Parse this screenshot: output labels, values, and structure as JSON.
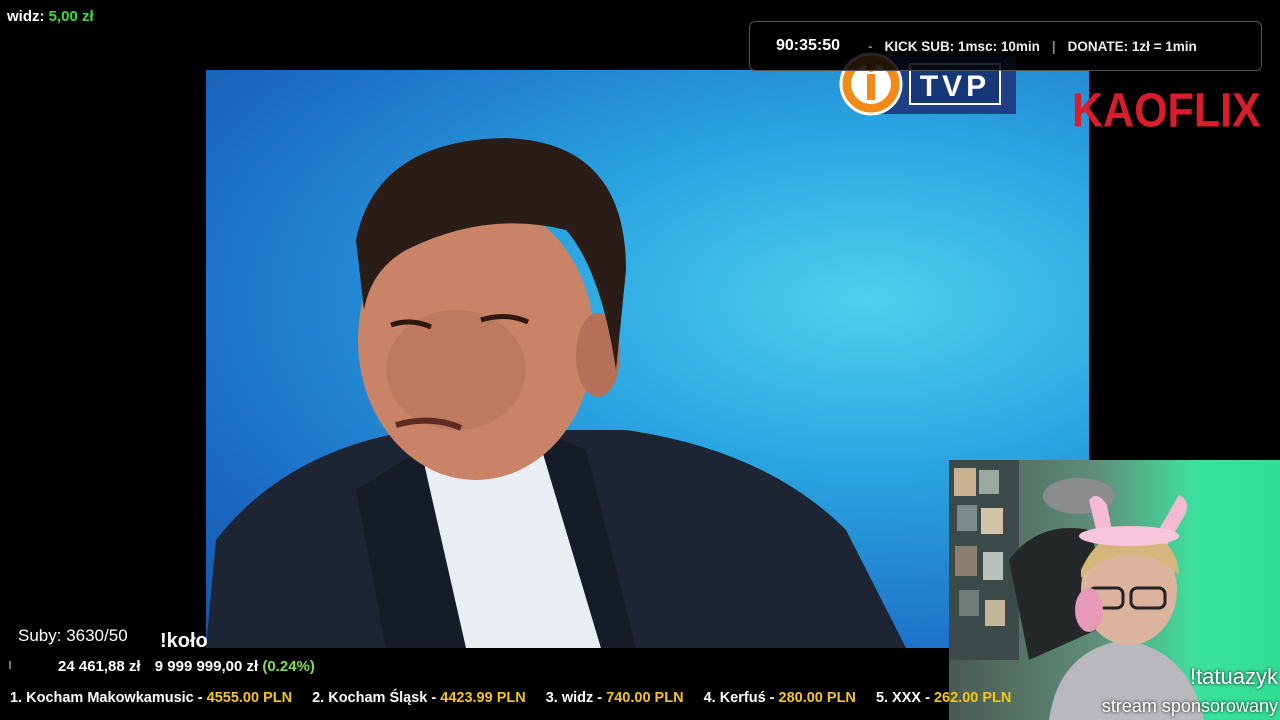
{
  "top_left": {
    "label": "widz:",
    "value": "5,00 zł"
  },
  "timer": {
    "time": "90:35:50",
    "dash": "-",
    "kick": "KICK SUB: 1msc: 10min",
    "sep": "|",
    "donate": "DONATE: 1zł = 1min"
  },
  "channel_logo": {
    "text": "TVP"
  },
  "brand": {
    "text": "KAOFLIX"
  },
  "subs": {
    "text": "Suby: 3630/50"
  },
  "kolo": {
    "text": "!koło"
  },
  "goal": {
    "amount": "24 461,88 zł",
    "target": "9 999 999,00 zł",
    "percent": "(0.24%)"
  },
  "ranking": [
    {
      "label": "1. Kocham Makowkamusic - ",
      "amount": "4555.00 PLN"
    },
    {
      "label": "2. Kocham Śląsk - ",
      "amount": "4423.99 PLN"
    },
    {
      "label": "3. widz - ",
      "amount": "740.00 PLN"
    },
    {
      "label": "4. Kerfuś - ",
      "amount": "280.00 PLN"
    },
    {
      "label": "5. XXX - ",
      "amount": "262.00 PLN"
    }
  ],
  "webcam": {
    "command": "!tatuazyk",
    "note": "stream sponsorowany"
  },
  "colors": {
    "accent_green": "#3ddc3d",
    "amount_yellow": "#f5c518",
    "brand_red": "#d81e2a"
  }
}
